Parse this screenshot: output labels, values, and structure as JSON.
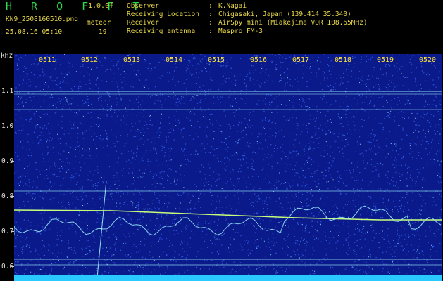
{
  "header": {
    "brand": "H R O F F T",
    "version": "1.0.0f",
    "filename": "KN9_2508160510.png",
    "datetime": "25.08.16 05:10",
    "meteor_label": "meteor",
    "meteor_count": "19",
    "meta": [
      {
        "key": "Observer",
        "value": "K.Nagai"
      },
      {
        "key": "Receiving Location",
        "value": "Chigasaki, Japan (139.414 35.340)"
      },
      {
        "key": "Receiver",
        "value": "AirSpy mini (Miakejima VOR 108.65MHz)"
      },
      {
        "key": "Receiving antenna",
        "value": "Maspro FM-3"
      }
    ]
  },
  "axis": {
    "unit": "kHz",
    "y_labels": [
      "1.1",
      "1.0",
      "0.9",
      "0.8",
      "0.7",
      "0.6"
    ],
    "x_labels": [
      "0511",
      "0512",
      "0513",
      "0514",
      "0515",
      "0516",
      "0517",
      "0518",
      "0519",
      "0520"
    ]
  },
  "colors": {
    "background": "#0b1a8a",
    "noise": "#3a6bff",
    "signal": "#9ff6ff",
    "trace": "#c8ff7a",
    "text_yellow": "#e8d84a",
    "text_green": "#2bd94a"
  }
}
